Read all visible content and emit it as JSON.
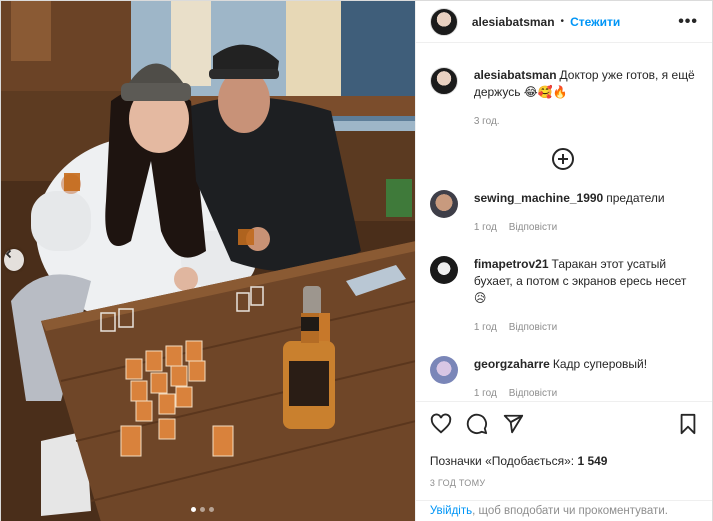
{
  "post": {
    "author": "alesiabatsman",
    "follow_label": "Стежити",
    "separator": "•",
    "more_label": "•••"
  },
  "caption": {
    "author": "alesiabatsman",
    "text": "Доктор уже готов, я ещё держусь 😂🥰🔥",
    "time": "3 год."
  },
  "comments": [
    {
      "author": "sewing_machine_1990",
      "text": "предатели",
      "time": "1 год",
      "reply": "Відповісти"
    },
    {
      "author": "fimapetrov21",
      "text": "Таракан этот усатый бухает, а потом с экранов ересь несет 😥",
      "time": "1 год",
      "reply": "Відповісти"
    },
    {
      "author": "georgzaharre",
      "text": "Кадр суперовый!",
      "time": "1 год",
      "reply": "Відповісти"
    }
  ],
  "likes": {
    "label": "Позначки «Подобається»:",
    "count": "1 549"
  },
  "timestamp": "3 ГОД ТОМУ",
  "login": {
    "link": "Увійдіть",
    "text": ", щоб вподобати чи прокоментувати."
  },
  "carousel": {
    "total": 3,
    "active": 1
  },
  "colors": {
    "accent": "#0095f6",
    "text": "#262626",
    "muted": "#8e8e8e"
  },
  "icons": [
    "chevron-left-icon",
    "heart-icon",
    "comment-icon",
    "share-icon",
    "bookmark-icon",
    "load-more-icon"
  ]
}
